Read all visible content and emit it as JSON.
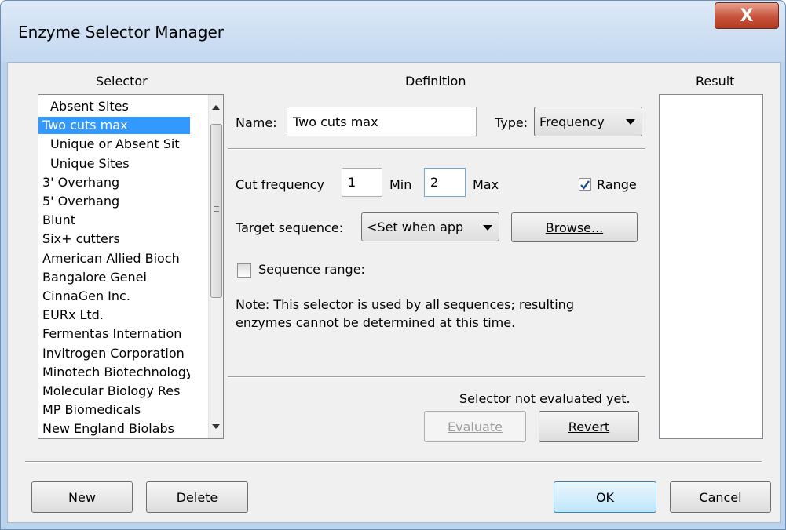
{
  "window": {
    "title": "Enzyme Selector Manager",
    "close_glyph": "X"
  },
  "columns": {
    "selector": "Selector",
    "definition": "Definition",
    "result": "Result"
  },
  "selector_list": {
    "items": [
      {
        "label": "Absent Sites",
        "indent": true,
        "selected": false
      },
      {
        "label": "Two cuts max",
        "indent": false,
        "selected": true
      },
      {
        "label": "Unique or Absent Sit",
        "indent": true,
        "selected": false
      },
      {
        "label": "Unique Sites",
        "indent": true,
        "selected": false
      },
      {
        "label": "3' Overhang",
        "indent": false,
        "selected": false
      },
      {
        "label": "5' Overhang",
        "indent": false,
        "selected": false
      },
      {
        "label": "Blunt",
        "indent": false,
        "selected": false
      },
      {
        "label": "Six+ cutters",
        "indent": false,
        "selected": false
      },
      {
        "label": "American Allied Bioch",
        "indent": false,
        "selected": false
      },
      {
        "label": "Bangalore Genei",
        "indent": false,
        "selected": false
      },
      {
        "label": "CinnaGen Inc.",
        "indent": false,
        "selected": false
      },
      {
        "label": "EURx Ltd.",
        "indent": false,
        "selected": false
      },
      {
        "label": "Fermentas Internation",
        "indent": false,
        "selected": false
      },
      {
        "label": "Invitrogen Corporation",
        "indent": false,
        "selected": false
      },
      {
        "label": "Minotech Biotechnology",
        "indent": false,
        "selected": false
      },
      {
        "label": "Molecular Biology Res",
        "indent": false,
        "selected": false
      },
      {
        "label": "MP Biomedicals",
        "indent": false,
        "selected": false
      },
      {
        "label": "New England Biolabs",
        "indent": false,
        "selected": false
      }
    ]
  },
  "definition": {
    "name_label": "Name:",
    "name_value": "Two cuts max",
    "type_label": "Type:",
    "type_value": "Frequency",
    "cut_frequency_label": "Cut frequency",
    "min_value": "1",
    "min_label": "Min",
    "max_value": "2",
    "max_label": "Max",
    "range_label": "Range",
    "range_checked": true,
    "target_label": "Target sequence:",
    "target_value": "<Set when app",
    "browse_label": "Browse...",
    "sequence_range_label": "Sequence range:",
    "sequence_range_checked": false,
    "note_line1": "Note: This selector is used by all sequences; resulting",
    "note_line2": "enzymes cannot be determined at this time.",
    "status": "Selector not evaluated yet.",
    "evaluate_label": "Evaluate",
    "revert_label": "Revert"
  },
  "footer": {
    "new_label": "New",
    "delete_label": "Delete",
    "ok_label": "OK",
    "cancel_label": "Cancel"
  },
  "colors": {
    "selection": "#3399ff",
    "title_bar": "#c3d8f0",
    "close_button": "#c6533b"
  }
}
